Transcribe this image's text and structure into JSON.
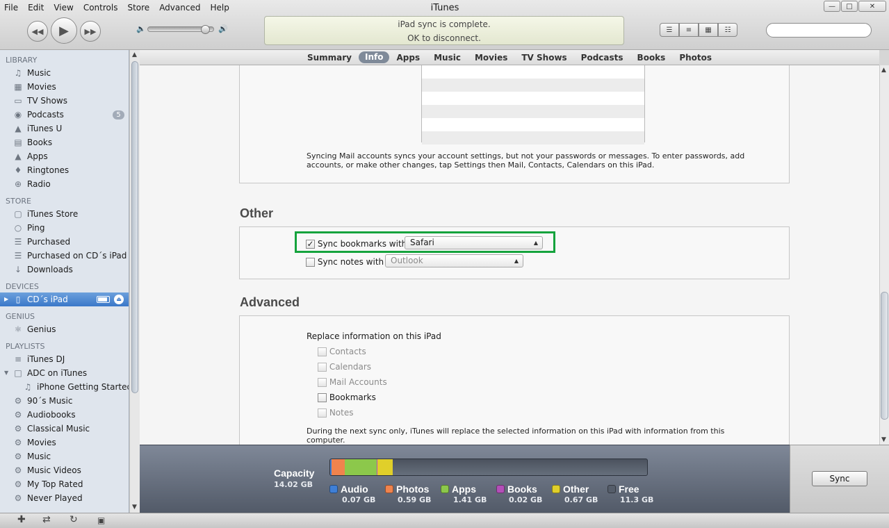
{
  "menu": [
    "File",
    "Edit",
    "View",
    "Controls",
    "Store",
    "Advanced",
    "Help"
  ],
  "window_title": "iTunes",
  "status": {
    "line1": "iPad sync is complete.",
    "line2": "OK to disconnect."
  },
  "search": {
    "placeholder": ""
  },
  "sidebar": {
    "library_header": "LIBRARY",
    "library": [
      {
        "label": "Music",
        "icon": "music-note-icon"
      },
      {
        "label": "Movies",
        "icon": "film-icon"
      },
      {
        "label": "TV Shows",
        "icon": "tv-icon"
      },
      {
        "label": "Podcasts",
        "icon": "podcast-icon",
        "badge": "5"
      },
      {
        "label": "iTunes U",
        "icon": "graduation-cap-icon"
      },
      {
        "label": "Books",
        "icon": "book-icon"
      },
      {
        "label": "Apps",
        "icon": "apps-icon"
      },
      {
        "label": "Ringtones",
        "icon": "bell-icon"
      },
      {
        "label": "Radio",
        "icon": "radio-icon"
      }
    ],
    "store_header": "STORE",
    "store": [
      {
        "label": "iTunes Store",
        "icon": "store-icon"
      },
      {
        "label": "Ping",
        "icon": "ping-icon"
      },
      {
        "label": "Purchased",
        "icon": "purchased-icon"
      },
      {
        "label": "Purchased on CD´s iPad",
        "icon": "purchased-icon"
      },
      {
        "label": "Downloads",
        "icon": "download-icon"
      }
    ],
    "devices_header": "DEVICES",
    "device": {
      "label": "CD´s iPad"
    },
    "genius_header": "GENIUS",
    "genius": [
      {
        "label": "Genius",
        "icon": "genius-icon"
      }
    ],
    "playlists_header": "PLAYLISTS",
    "playlists": [
      {
        "label": "iTunes DJ",
        "icon": "dj-icon"
      },
      {
        "label": "ADC on iTunes",
        "icon": "folder-icon"
      },
      {
        "label": "iPhone Getting Started...",
        "icon": "playlist-icon"
      },
      {
        "label": "90´s Music",
        "icon": "smart-playlist-gear-icon"
      },
      {
        "label": "Audiobooks",
        "icon": "smart-playlist-gear-icon"
      },
      {
        "label": "Classical Music",
        "icon": "smart-playlist-gear-icon"
      },
      {
        "label": "Movies",
        "icon": "smart-playlist-gear-icon"
      },
      {
        "label": "Music",
        "icon": "smart-playlist-gear-icon"
      },
      {
        "label": "Music Videos",
        "icon": "smart-playlist-gear-icon"
      },
      {
        "label": "My Top Rated",
        "icon": "smart-playlist-gear-icon"
      },
      {
        "label": "Never Played",
        "icon": "smart-playlist-gear-icon"
      }
    ]
  },
  "tabs": [
    "Summary",
    "Info",
    "Apps",
    "Music",
    "Movies",
    "TV Shows",
    "Podcasts",
    "Books",
    "Photos"
  ],
  "active_tab": "Info",
  "mail": {
    "note_line1": "Syncing Mail accounts syncs your account settings, but not your passwords or messages. To enter passwords, add",
    "note_line2": "accounts, or make other changes, tap Settings then Mail, Contacts, Calendars on this iPad."
  },
  "other": {
    "heading": "Other",
    "bookmarks_label": "Sync bookmarks with",
    "bookmarks_checked": true,
    "bookmarks_app": "Safari",
    "notes_label": "Sync notes with",
    "notes_checked": false,
    "notes_app": "Outlook"
  },
  "advanced": {
    "heading": "Advanced",
    "replace_label": "Replace information on this iPad",
    "options": [
      {
        "label": "Contacts",
        "enabled": false
      },
      {
        "label": "Calendars",
        "enabled": false
      },
      {
        "label": "Mail Accounts",
        "enabled": false
      },
      {
        "label": "Bookmarks",
        "enabled": true
      },
      {
        "label": "Notes",
        "enabled": false
      }
    ],
    "note_line1": "During the next sync only, iTunes will replace the selected information on this iPad with information from this",
    "note_line2": "computer."
  },
  "capacity": {
    "title": "Capacity",
    "total": "14.02 GB",
    "segments": [
      {
        "name": "Audio",
        "amount": "0.07 GB",
        "color": "#3f7fd6",
        "fraction": 0.005
      },
      {
        "name": "Photos",
        "amount": "0.59 GB",
        "color": "#f0834d",
        "fraction": 0.042
      },
      {
        "name": "Apps",
        "amount": "1.41 GB",
        "color": "#8cc84b",
        "fraction": 0.101
      },
      {
        "name": "Books",
        "amount": "0.02 GB",
        "color": "#b34fb8",
        "fraction": 0.002
      },
      {
        "name": "Other",
        "amount": "0.67 GB",
        "color": "#e0cf2a",
        "fraction": 0.048
      },
      {
        "name": "Free",
        "amount": "11.3 GB",
        "color": "#555d6a",
        "fraction": 0.802
      }
    ]
  },
  "sync_button": "Sync"
}
